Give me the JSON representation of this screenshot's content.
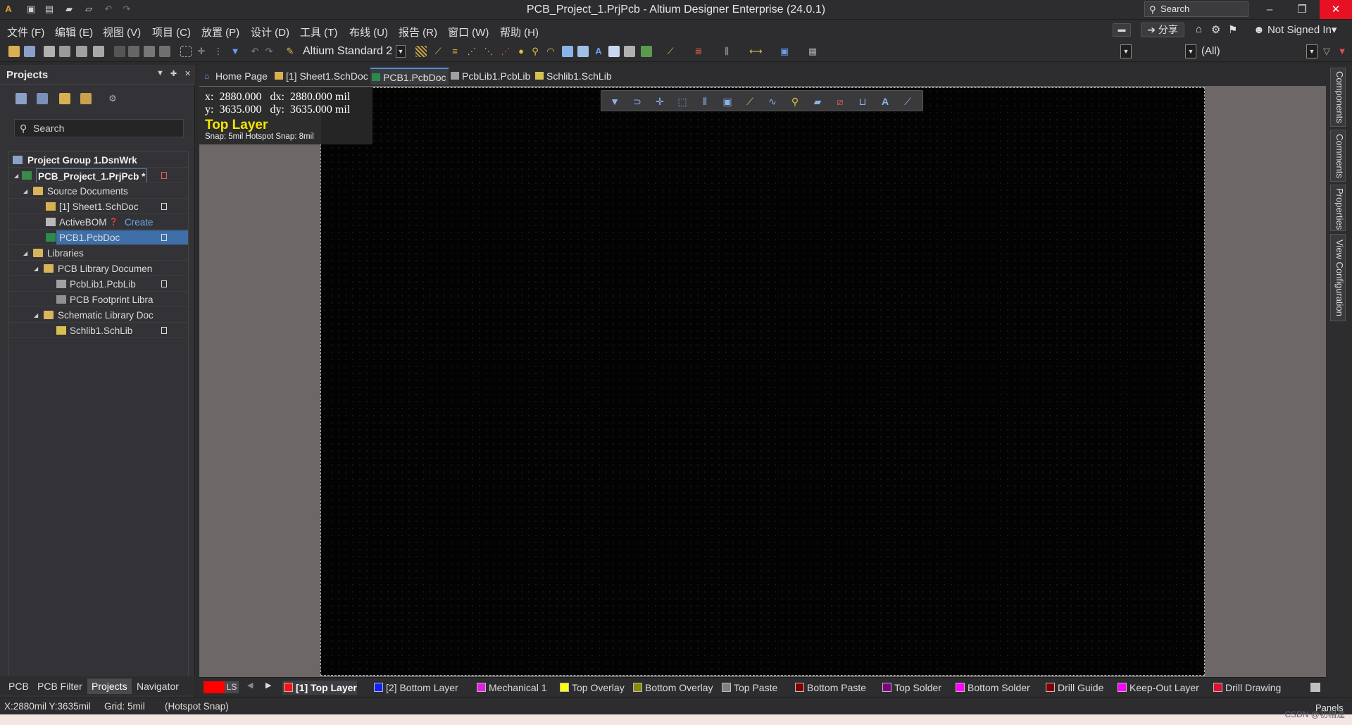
{
  "titlebar": {
    "title": "PCB_Project_1.PrjPcb - Altium Designer Enterprise (24.0.1)",
    "search_placeholder": "Search"
  },
  "menu": {
    "items": [
      "文件 (F)",
      "编辑 (E)",
      "视图 (V)",
      "项目 (C)",
      "放置 (P)",
      "设计 (D)",
      "工具 (T)",
      "布线 (U)",
      "报告 (R)",
      "窗口 (W)",
      "帮助 (H)"
    ],
    "share": "分享",
    "user": "Not Signed In"
  },
  "toolbar": {
    "standard_combo": "Altium Standard 2",
    "filter_all": "(All)"
  },
  "projects_panel": {
    "title": "Projects",
    "search_placeholder": "Search",
    "tree": {
      "group": "Project Group 1.DsnWrk",
      "project": "PCB_Project_1.PrjPcb *",
      "source_docs": "Source Documents",
      "sheet": "[1] Sheet1.SchDoc",
      "activebom": "ActiveBOM",
      "create": "Create",
      "pcb": "PCB1.PcbDoc",
      "libraries": "Libraries",
      "pcb_lib_docs": "PCB Library Documen",
      "pcblib": "PcbLib1.PcbLib",
      "footprint_lib": "PCB Footprint Libra",
      "sch_lib_docs": "Schematic Library Doc",
      "schlib": "Schlib1.SchLib"
    },
    "tabs": [
      "PCB",
      "PCB Filter",
      "Projects",
      "Navigator"
    ]
  },
  "doc_tabs": [
    "Home Page",
    "[1] Sheet1.SchDoc",
    "PCB1.PcbDoc",
    "PcbLib1.PcbLib",
    "Schlib1.SchLib"
  ],
  "hud": {
    "line1": "x:  2880.000   dx:  2880.000 mil",
    "line2": "y:  3635.000   dy:  3635.000 mil",
    "layer": "Top Layer",
    "snap": "Snap: 5mil Hotspot Snap: 8mil"
  },
  "right_tabs": [
    "Components",
    "Comments",
    "Properties",
    "View Configuration"
  ],
  "layers": {
    "ls": "LS",
    "items": [
      {
        "label": "[1] Top Layer",
        "color": "#ff1010"
      },
      {
        "label": "[2] Bottom Layer",
        "color": "#1020ff"
      },
      {
        "label": "Mechanical 1",
        "color": "#e020e0"
      },
      {
        "label": "Top Overlay",
        "color": "#ffff00"
      },
      {
        "label": "Bottom Overlay",
        "color": "#8a8a00"
      },
      {
        "label": "Top Paste",
        "color": "#808080"
      },
      {
        "label": "Bottom Paste",
        "color": "#800000"
      },
      {
        "label": "Top Solder",
        "color": "#800080"
      },
      {
        "label": "Bottom Solder",
        "color": "#ff00ff"
      },
      {
        "label": "Drill Guide",
        "color": "#800000"
      },
      {
        "label": "Keep-Out Layer",
        "color": "#ff00ff"
      },
      {
        "label": "Drill Drawing",
        "color": "#e01030"
      }
    ]
  },
  "status": {
    "coords": "X:2880mil Y:3635mil",
    "grid": "Grid: 5mil",
    "hotspot": "(Hotspot Snap)",
    "panels": "Panels",
    "watermark": "CSDN @初相逢"
  }
}
